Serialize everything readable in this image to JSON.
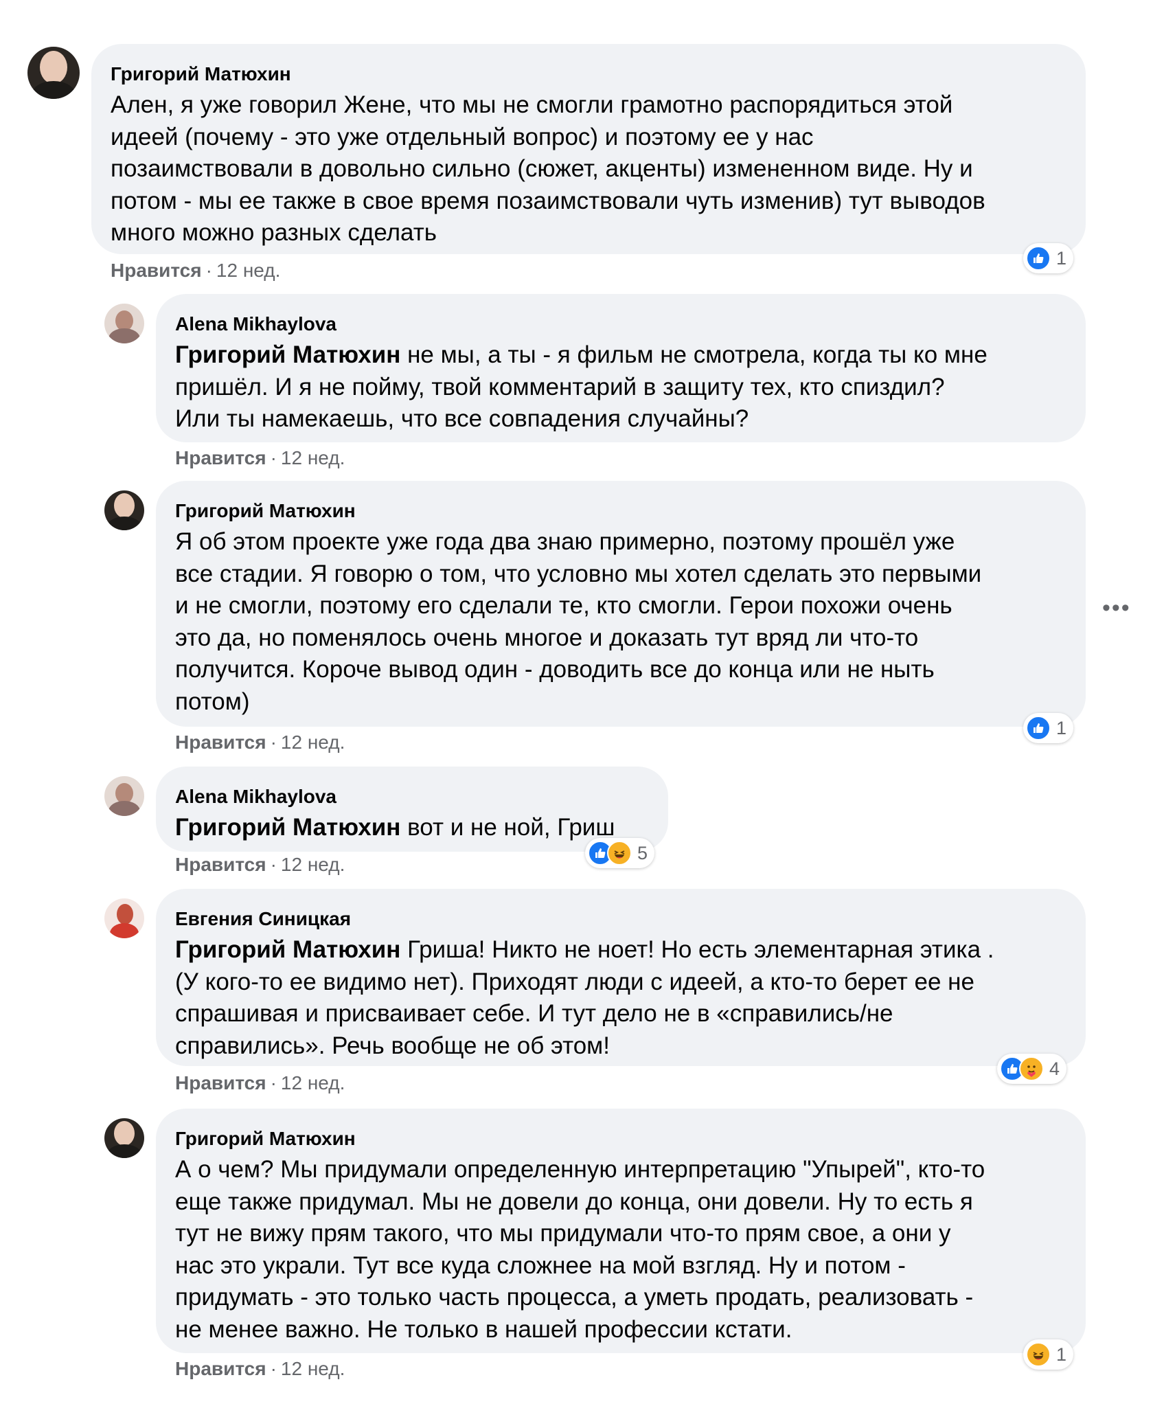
{
  "comments": [
    {
      "author": "Григорий Матюхин",
      "mention": "",
      "lines": [
        "Ален, я уже говорил Жене, что мы не смогли грамотно распорядиться этой",
        "идеей (почему - это уже отдельный вопрос) и поэтому ее у нас",
        "позаимствовали в довольно сильно (сюжет, акценты) измененном виде. Ну и",
        "потом - мы ее также в свое время позаимствовали чуть изменив) тут выводов",
        "много можно разных сделать"
      ],
      "like_label": "Нравится",
      "time": "12 нед.",
      "reaction_count": "1",
      "reaction_icons": [
        "like-icon"
      ]
    },
    {
      "author": "Alena Mikhaylova",
      "mention": "Григорий Матюхин",
      "lines": [
        " не мы, а ты - я фильм не смотрела, когда ты ко мне",
        "пришёл. И я не пойму, твой комментарий в защиту тех, кто спиздил?",
        "Или ты намекаешь, что все совпадения случайны?"
      ],
      "like_label": "Нравится",
      "time": "12 нед."
    },
    {
      "author": "Григорий Матюхин",
      "mention": "",
      "lines": [
        "Я об этом проекте уже года два знаю примерно, поэтому прошёл уже",
        "все стадии. Я говорю о том, что условно мы хотел сделать это первыми",
        "и не смогли, поэтому его сделали те, кто смогли. Герои похожи очень",
        "это да, но поменялось очень многое и доказать тут вряд ли что-то",
        "получится. Короче вывод один - доводить все до конца или не ныть",
        "потом)"
      ],
      "like_label": "Нравится",
      "time": "12 нед.",
      "reaction_count": "1",
      "reaction_icons": [
        "like-icon"
      ]
    },
    {
      "author": "Alena Mikhaylova",
      "mention": "Григорий Матюхин",
      "lines": [
        " вот и не ной, Гриш"
      ],
      "like_label": "Нравится",
      "time": "12 нед.",
      "reaction_count": "5",
      "reaction_icons": [
        "like-icon",
        "haha-icon"
      ]
    },
    {
      "author": "Евгения Синицкая",
      "mention": "Григорий Матюхин",
      "lines": [
        " Гриша! Никто не ноет! Но есть элементарная этика .",
        "(У кого-то ее видимо нет). Приходят люди с идеей, а кто-то берет ее не",
        "спрашивая и присваивает себе. И тут дело не в «справились/не",
        "справились». Речь вообще не об этом!"
      ],
      "like_label": "Нравится",
      "time": "12 нед.",
      "reaction_count": "4",
      "reaction_icons": [
        "like-icon",
        "care-icon"
      ]
    },
    {
      "author": "Григорий Матюхин",
      "mention": "",
      "lines": [
        "А о чем? Мы придумали определенную интерпретацию \"Упырей\", кто-то",
        "еще также придумал. Мы не довели до конца, они довели. Ну то есть я",
        "тут не вижу прям такого, что мы придумали что-то прям свое, а они у",
        "нас это украли. Тут все куда сложнее на мой взгляд. Ну и потом -",
        "придумать - это только часть процесса, а уметь продать, реализовать -",
        "не менее важно. Не только в нашей профессии кстати."
      ],
      "like_label": "Нравится",
      "time": "12 нед.",
      "reaction_count": "1",
      "reaction_icons": [
        "haha-icon"
      ]
    }
  ],
  "more_icon": "more-horizontal-icon",
  "colors": {
    "bubble": "#f0f2f5",
    "meta": "#65676b",
    "like_blue": "#1877f2",
    "haha_yellow": "#f7b125"
  }
}
